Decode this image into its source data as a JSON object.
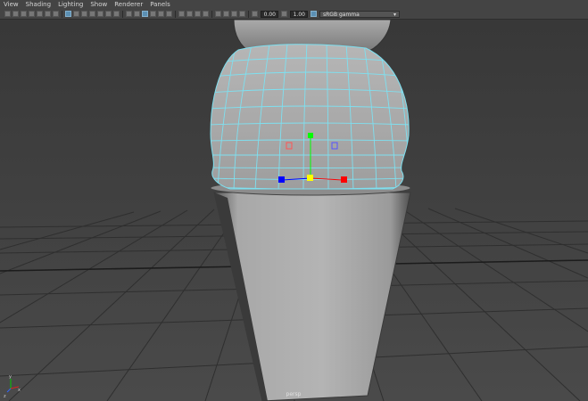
{
  "menus": [
    "View",
    "Shading",
    "Lighting",
    "Show",
    "Renderer",
    "Panels"
  ],
  "toolbar": {
    "exposure_value": "0.00",
    "gamma_value": "1.00",
    "color_space": "sRGB gamma"
  },
  "viewport": {
    "camera_label": "persp"
  },
  "colors": {
    "wireframe": "#7ee0f0",
    "manip_x": "#ff0000",
    "manip_y": "#00ff00",
    "manip_z": "#0000ff",
    "manip_center": "#ffff00"
  }
}
